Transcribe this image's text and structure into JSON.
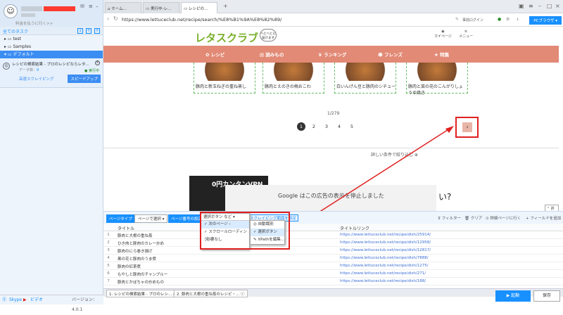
{
  "sidebar": {
    "upgrade": "料金を払うに行く>>",
    "all_tasks": "全てのタスク",
    "folders": [
      "test",
      "Samples",
      "デフォルト"
    ],
    "task": {
      "title": "レシピの検索結果 - プロのレシピならレタ...",
      "count_label": "データ数：",
      "count": "9",
      "status": "実行中",
      "run": "高速スクレイピング",
      "speedup": "スピードアップ"
    },
    "skype": "Skype",
    "video": "ビデオ",
    "version": "バージョン：4.0.1"
  },
  "tabs": [
    "ホーム...",
    "実行中-レ...",
    "レシピの..."
  ],
  "url": "https://www.lettuceclub.net/recipe/search/%E8%B1%9A%E8%82%89/",
  "login": "事前ログイン",
  "pcbrowser": "PCブラウザ",
  "site": {
    "logo": "レタスクラブ",
    "logo_sub": "へとへとに届けます",
    "mypage": "マイページ",
    "menu": "メニュー",
    "nav": [
      "レシピ",
      "読みもの",
      "ランキング",
      "フレンズ",
      "特集"
    ],
    "cards": [
      "豚肉と新玉ねぎの重ね蒸し",
      "豚肉とえのきの梅おこわ",
      "白いんげん豆と豚肉のシチュー",
      "豚肉と菜の花のこんがりしょうゆ焼き"
    ],
    "pagecount": "1/279",
    "pages": [
      "1",
      "2",
      "3",
      "4",
      "5"
    ],
    "next": "›",
    "detail": "詳しい条件で絞り込む",
    "ad": "0円カンタンVPN",
    "google": "Google はこの広告の表示を停止しました",
    "gq": "い?",
    "fold": "折る"
  },
  "tool": {
    "pagetype": "ページタイプ",
    "pagesel": "ページで選択",
    "pageset": "ページ番号の設定",
    "selbtn": "選択ボタン など",
    "scrape": "スクレイピング範囲を設定",
    "filter": "フィルター",
    "clear": "クリア",
    "detailpage": "詳細ページに行く",
    "addfield": "フィールドを追加"
  },
  "menu": {
    "items": [
      "次のページ",
      "スクロールローディング",
      "必要なし"
    ],
    "sub": [
      "自動識別",
      "選択ボタン",
      "XPathを編集..."
    ]
  },
  "table": {
    "headers": [
      "タイトル",
      "タイトルリンク"
    ],
    "rows": [
      [
        "1",
        "豚肉と大根の重ね蒸",
        "https://www.lettuceclub.net/recipe/dish/25914/"
      ],
      [
        "2",
        "ひき肉と豚肉のカレー炒め",
        "https://www.lettuceclub.net/recipe/dish/12958/"
      ],
      [
        "3",
        "豚肉のにら巻き揚げ",
        "https://www.lettuceclub.net/recipe/dish/12817/"
      ],
      [
        "4",
        "黒の花と豚肉のうま煮",
        "https://www.lettuceclub.net/recipe/dish/7888/"
      ],
      [
        "5",
        "豚肉の紅茶煮",
        "https://www.lettuceclub.net/recipe/dish/1275/"
      ],
      [
        "6",
        "もやしと豚肉のチャンプルー",
        "https://www.lettuceclub.net/recipe/dish/271/"
      ],
      [
        "7",
        "豚肉とかぼちゃの炒めもの",
        "https://www.lettuceclub.net/recipe/dish/188/"
      ]
    ]
  },
  "btabs": [
    "1. レシピの検索結果 - プロのレシ...",
    "2. 豚肉と大根の重ね蒸のレシピ・..."
  ],
  "run": "▶ 起動",
  "save": "保存"
}
